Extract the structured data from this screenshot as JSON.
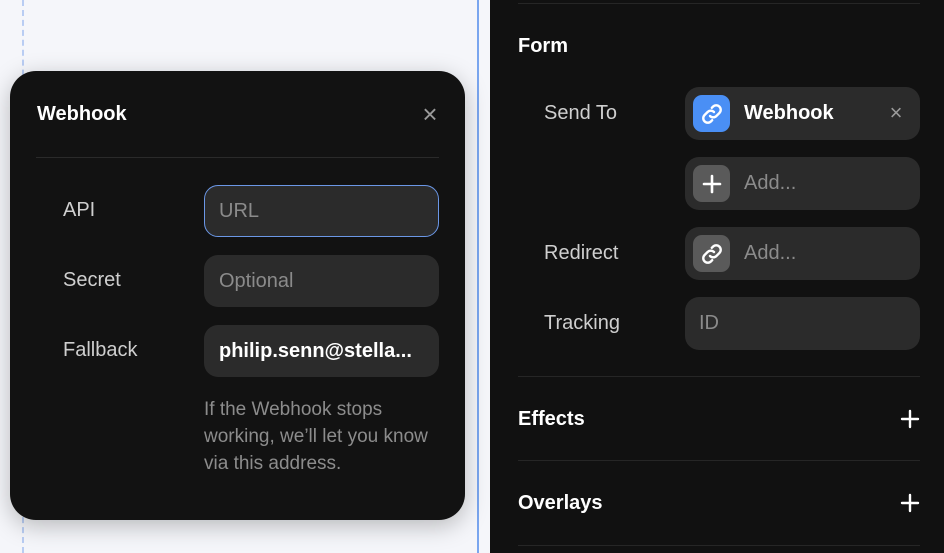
{
  "popover": {
    "title": "Webhook",
    "close_glyph": "×",
    "fields": [
      {
        "label": "API",
        "placeholder": "URL",
        "value": ""
      },
      {
        "label": "Secret",
        "placeholder": "Optional",
        "value": ""
      },
      {
        "label": "Fallback",
        "placeholder": "",
        "value": "philip.senn@stella..."
      }
    ],
    "help_text": "If the Webhook stops working, we’ll let you know via this address."
  },
  "panel": {
    "form": {
      "title": "Form",
      "send_to": {
        "label": "Send To",
        "selected": {
          "text": "Webhook",
          "icon": "link-icon",
          "remove_glyph": "×"
        },
        "add": {
          "text": "Add...",
          "icon": "plus-icon"
        }
      },
      "redirect": {
        "label": "Redirect",
        "text": "Add...",
        "icon": "link-icon"
      },
      "tracking": {
        "label": "Tracking",
        "placeholder": "ID"
      }
    },
    "effects": {
      "title": "Effects",
      "icon": "plus-icon"
    },
    "overlays": {
      "title": "Overlays",
      "icon": "plus-icon"
    }
  },
  "colors": {
    "accent": "#4a8ff5",
    "panel_bg": "#111111",
    "field_bg": "#2b2b2b",
    "focus_border": "#6b97e6"
  }
}
